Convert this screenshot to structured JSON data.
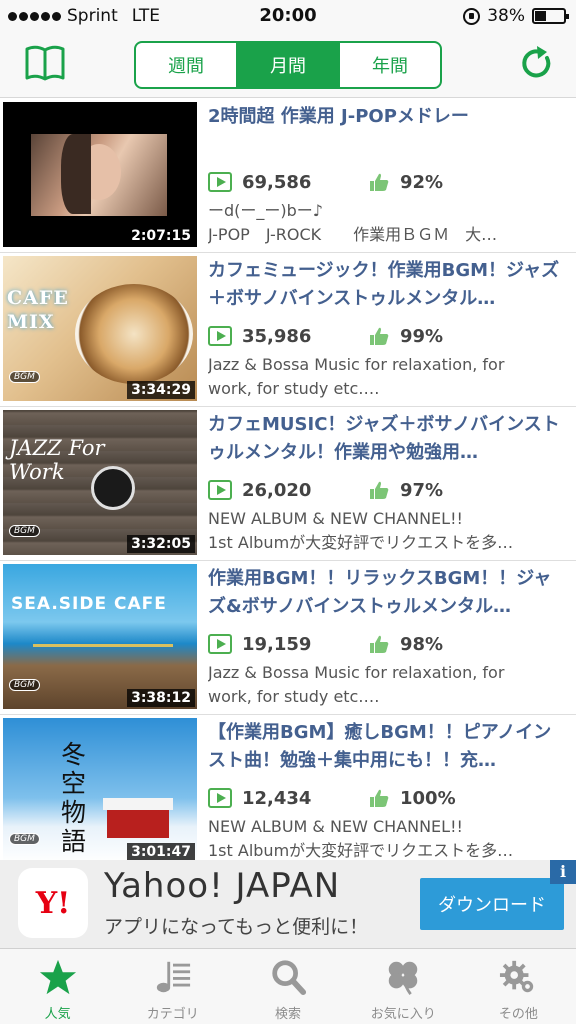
{
  "status": {
    "carrier": "Sprint",
    "network": "LTE",
    "time": "20:00",
    "battery": "38%",
    "battery_level": 0.38
  },
  "header": {
    "tabs": [
      {
        "label": "週間",
        "active": false
      },
      {
        "label": "月間",
        "active": true
      },
      {
        "label": "年間",
        "active": false
      }
    ]
  },
  "videos": [
    {
      "title": "2時間超 作業用 J-POPメドレー",
      "views": "69,586",
      "rating": "92%",
      "desc": "ーd(ー_ー)bー♪\nJ-POP　J-ROCK　　作業用ＢＧＭ　大…",
      "duration": "2:07:15"
    },
    {
      "title": "カフェミュージック！作業用BGM！ジャズ＋ボサノバインストゥルメンタル…",
      "views": "35,986",
      "rating": "99%",
      "desc": "Jazz & Bossa Music for relaxation, for\nwork, for study etc.…",
      "duration": "3:34:29",
      "thumb_text": "CAFE MIX"
    },
    {
      "title": "カフェMUSIC！ジャズ＋ボサノバインストゥルメンタル！作業用や勉強用…",
      "views": "26,020",
      "rating": "97%",
      "desc": "NEW ALBUM & NEW CHANNEL!!\n1st Albumが大変好評でリクエストを多…",
      "duration": "3:32:05",
      "thumb_text": "JAZZ For Work"
    },
    {
      "title": "作業用BGM！！リラックスBGM！！ジャズ&ボサノバインストゥルメンタル…",
      "views": "19,159",
      "rating": "98%",
      "desc": "Jazz & Bossa Music for relaxation, for\nwork, for study etc.…",
      "duration": "3:38:12",
      "thumb_text": "SEA.SIDE CAFE"
    },
    {
      "title": "【作業用BGM】癒しBGM！！ピアノインスト曲！勉強＋集中用にも！！充…",
      "views": "12,434",
      "rating": "100%",
      "desc": "NEW ALBUM & NEW CHANNEL!!\n1st Albumが大変好評でリクエストを多…",
      "duration": "3:01:47",
      "thumb_text": "冬空物語"
    }
  ],
  "ad": {
    "logo": "Y!",
    "title": "Yahoo! JAPAN",
    "subtitle": "アプリになってもっと便利に！",
    "button": "ダウンロード",
    "info": "i"
  },
  "tabbar": [
    {
      "label": "人気",
      "icon": "star-icon",
      "active": true
    },
    {
      "label": "カテゴリ",
      "icon": "music-list-icon",
      "active": false
    },
    {
      "label": "検索",
      "icon": "search-icon",
      "active": false
    },
    {
      "label": "お気に入り",
      "icon": "clover-icon",
      "active": false
    },
    {
      "label": "その他",
      "icon": "gear-icon",
      "active": false
    }
  ],
  "colors": {
    "accent": "#1aa24a",
    "title_text": "#44608f",
    "ad_button": "#2d9bd8"
  }
}
